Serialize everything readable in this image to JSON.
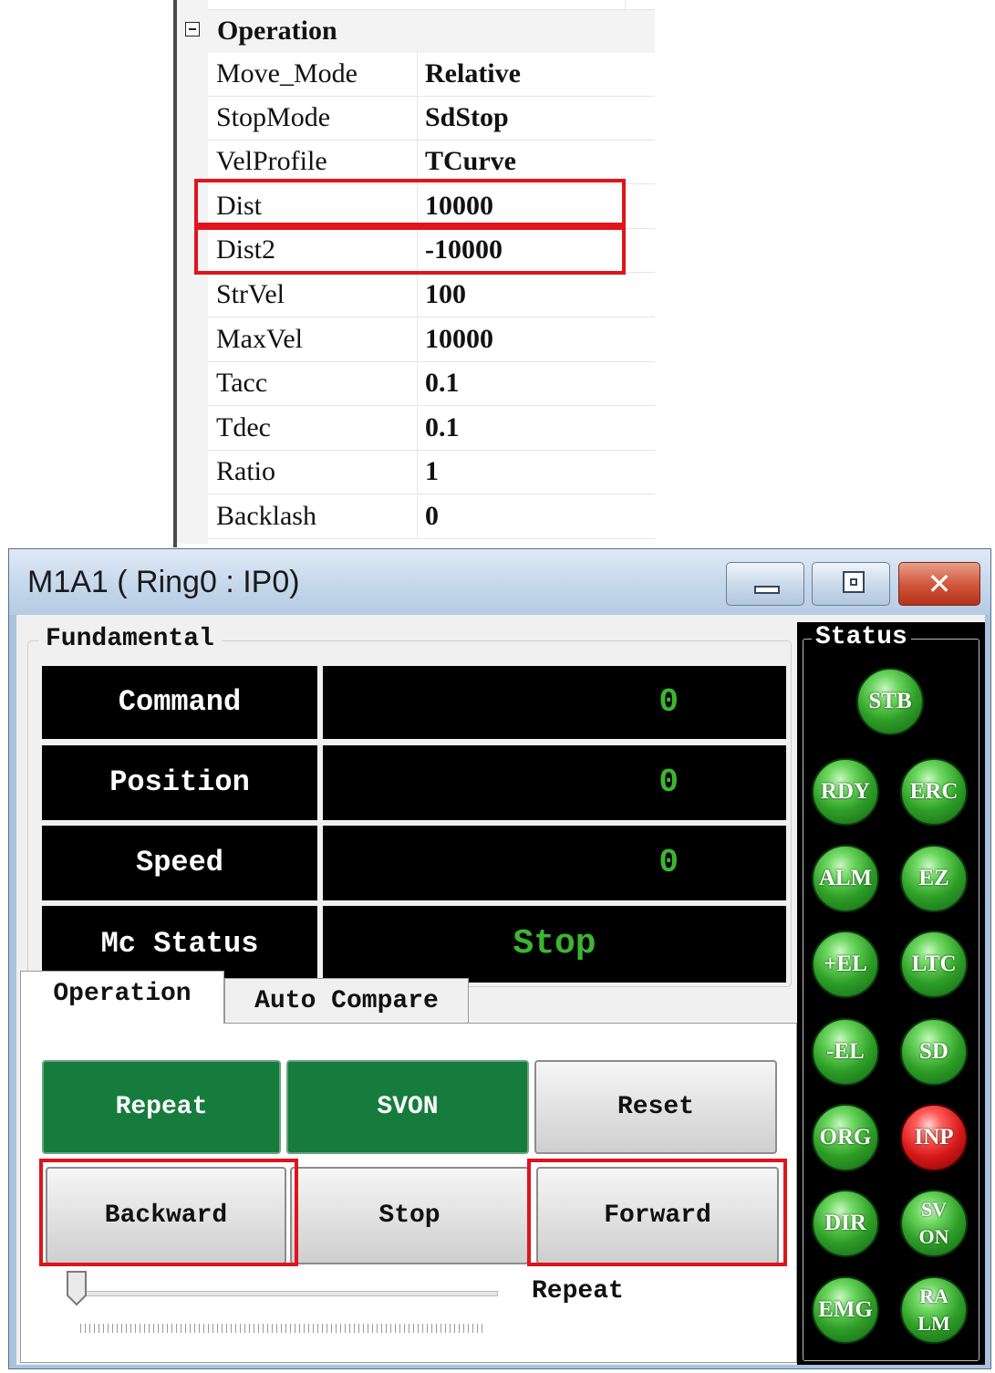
{
  "property_grid": {
    "category": "Operation",
    "rows": [
      {
        "name": "Move_Mode",
        "value": "Relative"
      },
      {
        "name": "StopMode",
        "value": "SdStop"
      },
      {
        "name": "VelProfile",
        "value": "TCurve"
      },
      {
        "name": "Dist",
        "value": "10000"
      },
      {
        "name": "Dist2",
        "value": "-10000"
      },
      {
        "name": "StrVel",
        "value": "100"
      },
      {
        "name": "MaxVel",
        "value": "10000"
      },
      {
        "name": "Tacc",
        "value": "0.1"
      },
      {
        "name": "Tdec",
        "value": "0.1"
      },
      {
        "name": "Ratio",
        "value": "1"
      },
      {
        "name": "Backlash",
        "value": "0"
      }
    ]
  },
  "window": {
    "title": "M1A1 ( Ring0 : IP0)",
    "close_glyph": "✕"
  },
  "fundamental": {
    "group_label": "Fundamental",
    "rows": [
      {
        "label": "Command",
        "value": "0"
      },
      {
        "label": "Position",
        "value": "0"
      },
      {
        "label": "Speed",
        "value": "0"
      },
      {
        "label": "Mc Status",
        "value": "Stop"
      }
    ]
  },
  "status": {
    "label": "Status",
    "leds": [
      {
        "text": "STB",
        "color": "green"
      },
      {
        "text": "RDY",
        "color": "green"
      },
      {
        "text": "ERC",
        "color": "green"
      },
      {
        "text": "ALM",
        "color": "green"
      },
      {
        "text": "EZ",
        "color": "green"
      },
      {
        "text": "+EL",
        "color": "green"
      },
      {
        "text": "LTC",
        "color": "green"
      },
      {
        "text": "-EL",
        "color": "green"
      },
      {
        "text": "SD",
        "color": "green"
      },
      {
        "text": "ORG",
        "color": "green"
      },
      {
        "text": "INP",
        "color": "red"
      },
      {
        "text": "DIR",
        "color": "green"
      },
      {
        "text": "SVON",
        "color": "green"
      },
      {
        "text": "EMG",
        "color": "green"
      },
      {
        "text": "RALM",
        "color": "green"
      }
    ]
  },
  "tabs": [
    {
      "label": "Operation",
      "active": true
    },
    {
      "label": "Auto Compare",
      "active": false
    }
  ],
  "operation": {
    "buttons": [
      {
        "label": "Repeat",
        "state": "on"
      },
      {
        "label": "SVON",
        "state": "on"
      },
      {
        "label": "Reset",
        "state": "normal"
      },
      {
        "label": "Backward",
        "state": "normal"
      },
      {
        "label": "Stop",
        "state": "normal"
      },
      {
        "label": "Forward",
        "state": "normal"
      }
    ],
    "slider_label": "Repeat",
    "slider_value": 0
  },
  "colors": {
    "highlight": "#e0141c",
    "value_green": "#3cb531",
    "button_on": "#167c3d",
    "led_green": "#2e9e26",
    "led_red": "#d81a1a"
  }
}
